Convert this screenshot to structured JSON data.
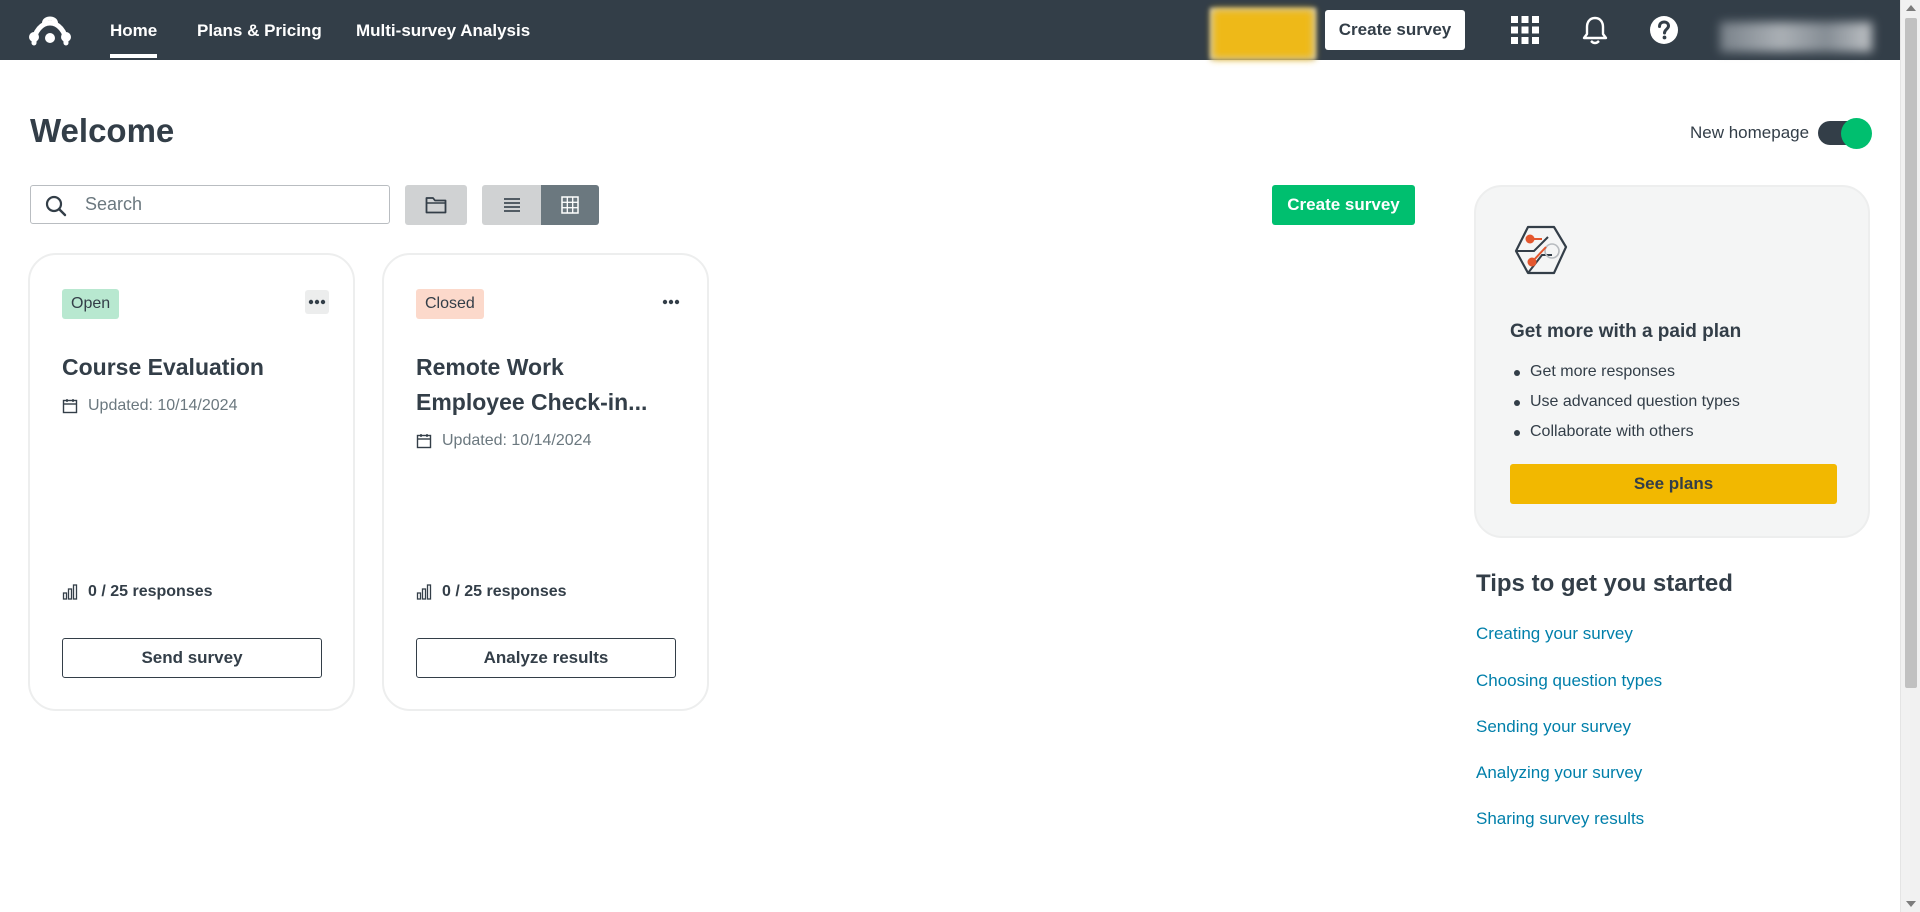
{
  "nav": {
    "home": "Home",
    "plans": "Plans & Pricing",
    "multi": "Multi-survey Analysis",
    "create_survey": "Create survey"
  },
  "icons": {
    "logo": "surveymonkey-logo",
    "apps": "apps-grid-icon",
    "notifications": "bell-icon",
    "help": "help-icon"
  },
  "main": {
    "title": "Welcome",
    "toggle_label": "New homepage",
    "toggle_on": true,
    "search_placeholder": "Search",
    "create_survey": "Create survey"
  },
  "surveys": [
    {
      "status": "Open",
      "title": "Course Evaluation",
      "updated": "Updated: 10/14/2024",
      "responses": "0 / 25 responses",
      "action": "Send survey"
    },
    {
      "status": "Closed",
      "title": "Remote Work Employee Check-in...",
      "updated": "Updated: 10/14/2024",
      "responses": "0 / 25 responses",
      "action": "Analyze results"
    }
  ],
  "promo": {
    "title": "Get more with a paid plan",
    "items": [
      "Get more responses",
      "Use advanced question types",
      "Collaborate with others"
    ],
    "button": "See plans"
  },
  "tips": {
    "title": "Tips to get you started",
    "links": [
      "Creating your survey",
      "Choosing question types",
      "Sending your survey",
      "Analyzing your survey",
      "Sharing survey results"
    ]
  },
  "colors": {
    "nav_bg": "#333e48",
    "primary": "#00bf6f",
    "upgrade": "#f2b800",
    "link": "#007faa",
    "open_badge": "#b8e8d0",
    "closed_badge": "#fcd9cb"
  }
}
